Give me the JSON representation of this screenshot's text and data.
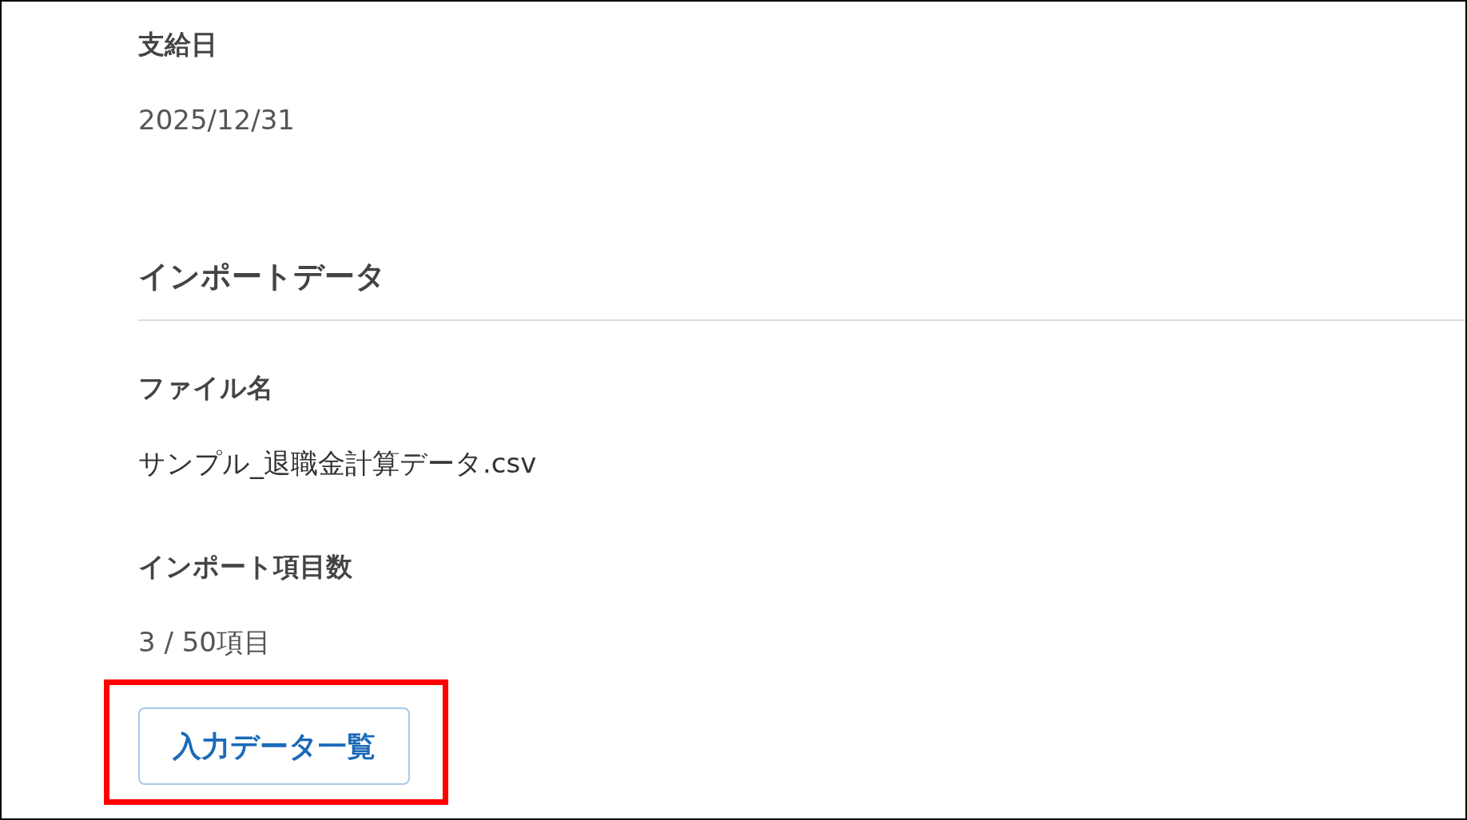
{
  "payment_date": {
    "label": "支給日",
    "value": "2025/12/31"
  },
  "import_section": {
    "heading": "インポートデータ",
    "fields": [
      {
        "label": "ファイル名",
        "value": "サンプル_退職金計算データ.csv",
        "kind": "dark"
      },
      {
        "label": "インポート項目数",
        "value": "3 / 50項目",
        "kind": "muted"
      }
    ],
    "button": "入力データ一覧"
  }
}
